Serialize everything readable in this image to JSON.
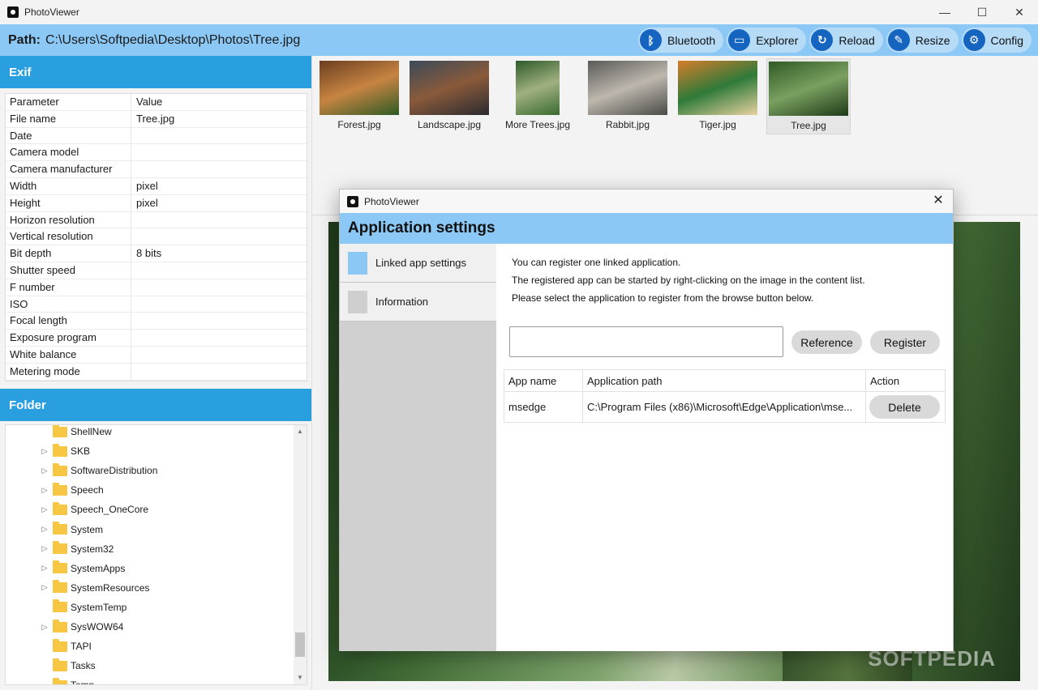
{
  "window": {
    "title": "PhotoViewer",
    "minimize": "—",
    "maximize": "☐",
    "close": "✕"
  },
  "pathbar": {
    "label": "Path:",
    "value": "C:\\Users\\Softpedia\\Desktop\\Photos\\Tree.jpg"
  },
  "toolbar": [
    {
      "label": "Bluetooth",
      "icon": "bluetooth-icon",
      "glyph": "ᛒ"
    },
    {
      "label": "Explorer",
      "icon": "folder-icon",
      "glyph": "▭"
    },
    {
      "label": "Reload",
      "icon": "reload-icon",
      "glyph": "↻"
    },
    {
      "label": "Resize",
      "icon": "resize-icon",
      "glyph": "✎"
    },
    {
      "label": "Config",
      "icon": "gear-icon",
      "glyph": "⚙"
    }
  ],
  "exif": {
    "header": "Exif",
    "columns": [
      "Parameter",
      "Value"
    ],
    "rows": [
      [
        "File name",
        "Tree.jpg"
      ],
      [
        "Date",
        ""
      ],
      [
        "Camera model",
        ""
      ],
      [
        "Camera manufacturer",
        ""
      ],
      [
        "Width",
        " pixel"
      ],
      [
        "Height",
        " pixel"
      ],
      [
        "Horizon resolution",
        ""
      ],
      [
        "Vertical resolution",
        ""
      ],
      [
        "Bit depth",
        "8 bits"
      ],
      [
        "Shutter speed",
        ""
      ],
      [
        "F number",
        ""
      ],
      [
        "ISO",
        ""
      ],
      [
        "Focal length",
        ""
      ],
      [
        "Exposure program",
        ""
      ],
      [
        "White balance",
        ""
      ],
      [
        "Metering mode",
        ""
      ]
    ]
  },
  "folder": {
    "header": "Folder",
    "items": [
      {
        "name": "ShellNew",
        "expandable": false
      },
      {
        "name": "SKB",
        "expandable": true
      },
      {
        "name": "SoftwareDistribution",
        "expandable": true
      },
      {
        "name": "Speech",
        "expandable": true
      },
      {
        "name": "Speech_OneCore",
        "expandable": true
      },
      {
        "name": "System",
        "expandable": true
      },
      {
        "name": "System32",
        "expandable": true
      },
      {
        "name": "SystemApps",
        "expandable": true
      },
      {
        "name": "SystemResources",
        "expandable": true
      },
      {
        "name": "SystemTemp",
        "expandable": false
      },
      {
        "name": "SysWOW64",
        "expandable": true
      },
      {
        "name": "TAPI",
        "expandable": false
      },
      {
        "name": "Tasks",
        "expandable": false
      },
      {
        "name": "Temp",
        "expandable": false
      }
    ]
  },
  "thumbnails": [
    {
      "name": "Forest.jpg",
      "selected": false,
      "colors": [
        "#6b3e1f",
        "#c78442",
        "#2f5a25"
      ]
    },
    {
      "name": "Landscape.jpg",
      "selected": false,
      "colors": [
        "#3b4a5a",
        "#8a5a3a",
        "#2a2a30"
      ]
    },
    {
      "name": "More Trees.jpg",
      "selected": false,
      "colors": [
        "#2e5a2a",
        "#a0b080",
        "#3a6b30"
      ]
    },
    {
      "name": "Rabbit.jpg",
      "selected": false,
      "colors": [
        "#5a5a58",
        "#bdb7ad",
        "#4a4a46"
      ]
    },
    {
      "name": "Tiger.jpg",
      "selected": false,
      "colors": [
        "#d67d2a",
        "#2f7a3a",
        "#e8d2a0"
      ]
    },
    {
      "name": "Tree.jpg",
      "selected": true,
      "colors": [
        "#2f5a25",
        "#7aa060",
        "#1f3a18"
      ]
    }
  ],
  "watermark": "SOFTPEDIA",
  "dialog": {
    "title": "PhotoViewer",
    "close": "✕",
    "header": "Application settings",
    "menu": [
      {
        "label": "Linked app settings",
        "color": "#8cc8f5"
      },
      {
        "label": "Information",
        "color": "#cfcfcf"
      }
    ],
    "description": [
      "You can register one linked application.",
      "The registered app can be started by right-clicking on the image in the content list.",
      "Please select the application to register from the browse button below."
    ],
    "path_input_value": "",
    "reference_button": "Reference",
    "register_button": "Register",
    "table": {
      "columns": [
        "App name",
        "Application path",
        "Action"
      ],
      "rows": [
        {
          "app": "msedge",
          "path": "C:\\Program Files (x86)\\Microsoft\\Edge\\Application\\mse...",
          "action": "Delete"
        }
      ]
    }
  }
}
